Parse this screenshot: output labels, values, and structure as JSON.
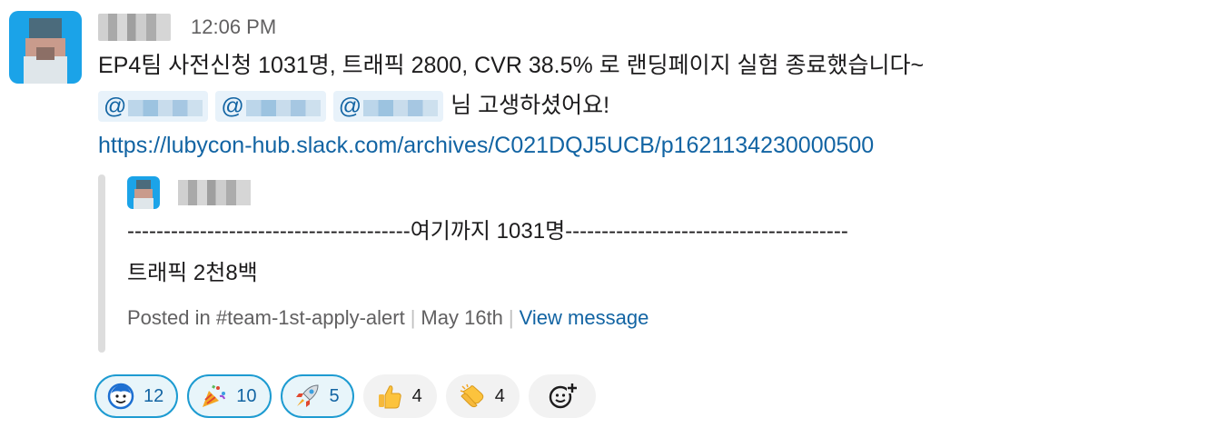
{
  "message": {
    "timestamp": "12:06 PM",
    "line1": "EP4팀 사전신청 1031명, 트래픽 2800, CVR 38.5% 로 랜딩페이지 실험 종료했습니다~",
    "mentions": [
      "@",
      "@",
      "@"
    ],
    "line2_suffix": "님 고생하셨어요!",
    "link": "https://lubycon-hub.slack.com/archives/C021DQJ5UCB/p1621134230000500"
  },
  "quote": {
    "line1": "---------------------------------------여기까지 1031명---------------------------------------",
    "line2": "트래픽 2천8백",
    "posted_in": "Posted in #team-1st-apply-alert",
    "date": "May 16th",
    "view_label": "View message"
  },
  "reactions": [
    {
      "icon": "smiling-face-icon",
      "count": "12",
      "active": true
    },
    {
      "icon": "party-popper-icon",
      "count": "10",
      "active": true
    },
    {
      "icon": "rocket-icon",
      "count": "5",
      "active": true
    },
    {
      "icon": "thumbs-up-icon",
      "count": "4",
      "active": false
    },
    {
      "icon": "clapping-hands-icon",
      "count": "4",
      "active": false
    }
  ],
  "colors": {
    "link": "#1264a3",
    "mention_bg": "#e8f2fa",
    "active_border": "#1d9bd1"
  }
}
